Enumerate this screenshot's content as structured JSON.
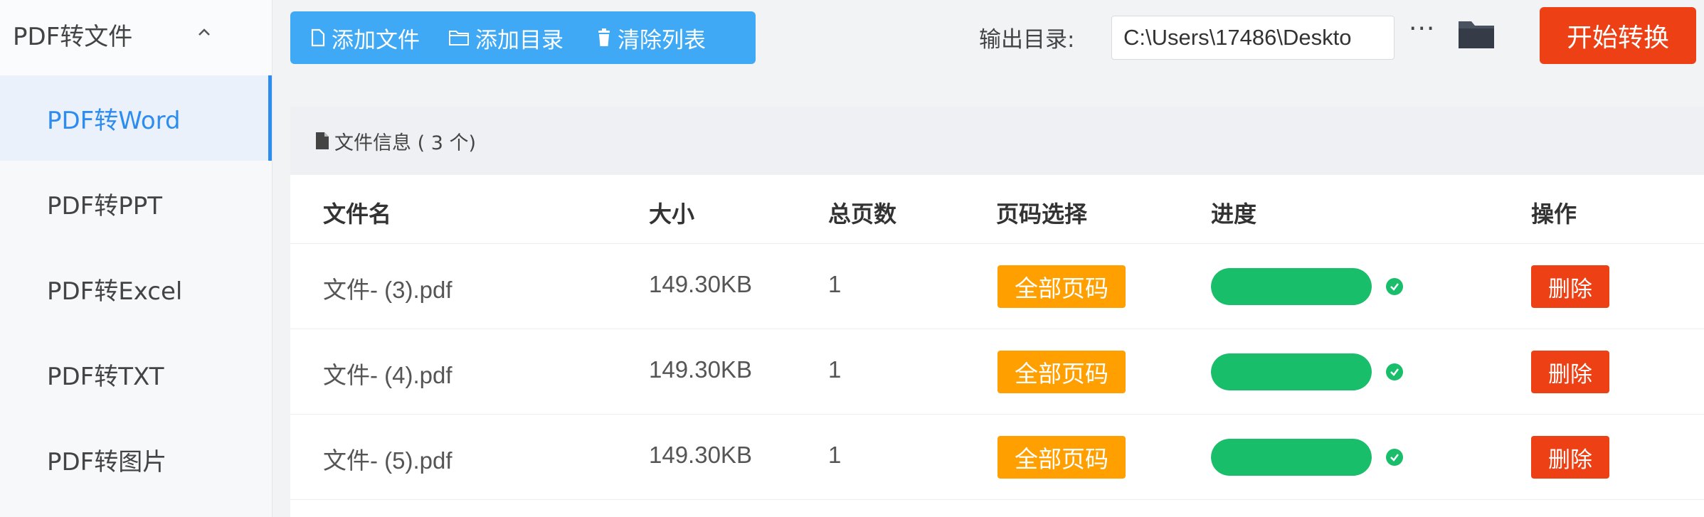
{
  "sidebar": {
    "group_label": "PDF转文件",
    "items": [
      {
        "label": "PDF转Word",
        "active": true
      },
      {
        "label": "PDF转PPT",
        "active": false
      },
      {
        "label": "PDF转Excel",
        "active": false
      },
      {
        "label": "PDF转TXT",
        "active": false
      },
      {
        "label": "PDF转图片",
        "active": false
      }
    ]
  },
  "toolbar": {
    "add_file": "添加文件",
    "add_folder": "添加目录",
    "clear_list": "清除列表",
    "output_label": "输出目录:",
    "output_path": "C:\\Users\\17486\\Deskto",
    "more": "···",
    "start": "开始转换"
  },
  "panel": {
    "title": "文件信息 ( 3 个)",
    "headers": [
      "文件名",
      "大小",
      "总页数",
      "页码选择",
      "进度",
      "操作"
    ],
    "rows": [
      {
        "name": "文件- (3).pdf",
        "size": "149.30KB",
        "pages": "1",
        "page_select": "全部页码",
        "progress": 1.0,
        "action": "删除"
      },
      {
        "name": "文件- (4).pdf",
        "size": "149.30KB",
        "pages": "1",
        "page_select": "全部页码",
        "progress": 1.0,
        "action": "删除"
      },
      {
        "name": "文件- (5).pdf",
        "size": "149.30KB",
        "pages": "1",
        "page_select": "全部页码",
        "progress": 1.0,
        "action": "删除"
      }
    ]
  },
  "colors": {
    "accent": "#2d8cf0",
    "toolbar": "#3fa9f5",
    "danger": "#ed4014",
    "warning": "#ff9f00",
    "success": "#19be6b"
  }
}
